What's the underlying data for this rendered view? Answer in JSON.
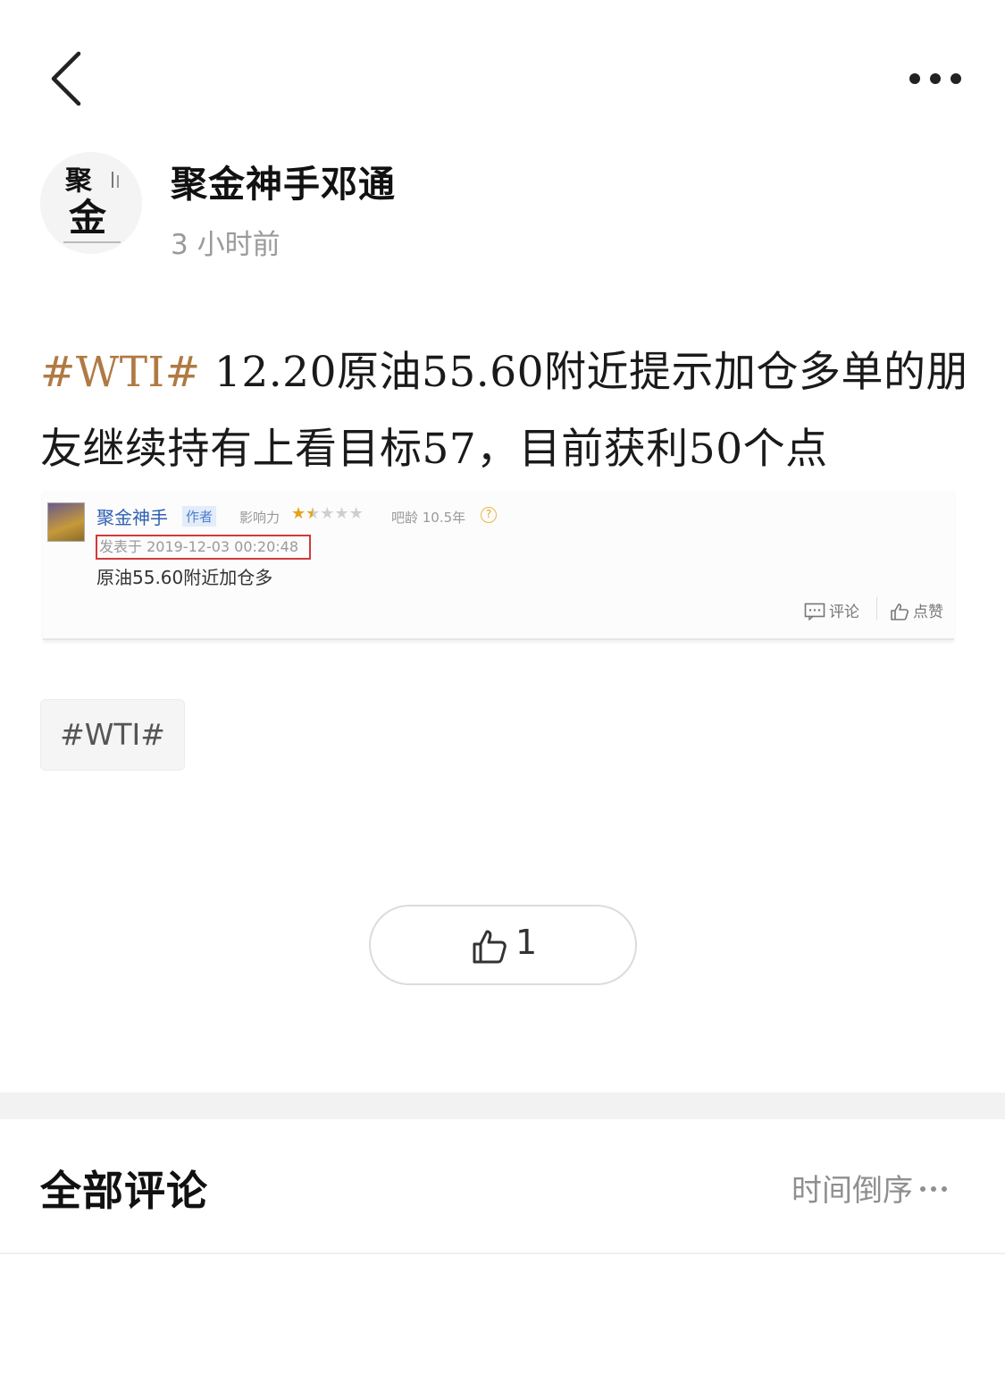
{
  "header": {
    "back_icon": "chevron-left-icon",
    "more_icon": "more-horizontal-icon"
  },
  "author": {
    "name": "聚金神手邓通",
    "time": "3 小时前",
    "avatar_text": "聚金"
  },
  "post": {
    "topic_tag": "#WTI#",
    "text": " 12.20原油55.60附近提示加仓多单的朋友继续持有上看目标57，目前获利50个点"
  },
  "screenshot": {
    "name": "聚金神手",
    "badge": "作者",
    "influence_label": "影响力",
    "stars_filled": 1.5,
    "stars_total": 5,
    "age": "吧龄 10.5年",
    "help": "?",
    "date": "发表于 2019-12-03 00:20:48",
    "content": "原油55.60附近加仓多",
    "comment_label": "评论",
    "like_label": "点赞"
  },
  "topic_chip": "#WTI#",
  "like": {
    "icon": "thumbs-up-icon",
    "count": "1"
  },
  "comments": {
    "title": "全部评论",
    "sort_label": "时间倒序"
  },
  "colors": {
    "topic": "#b07a44",
    "highlight_box": "#d23a3a",
    "link_blue": "#2f5fb3",
    "star": "#e8a11a",
    "band": "#f2f2f2"
  }
}
